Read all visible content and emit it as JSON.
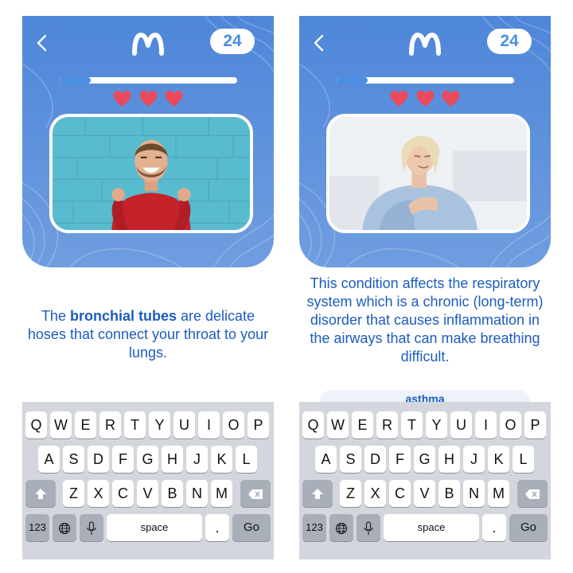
{
  "screens": [
    {
      "score": "24",
      "progress": 0.18,
      "hearts": 3,
      "photo": "smiling man in red sweater laughing against blue brick wall",
      "text_before": "The ",
      "term": "bronchial tubes",
      "text_after": " are delicate hoses that connect your throat to your lungs."
    },
    {
      "score": "24",
      "progress": 0.18,
      "hearts": 3,
      "photo": "woman holding chest, struggling to breathe",
      "text": "This condition affects the respiratory system which is a chronic (long-term) disorder that causes inflammation in the airways that can make breathing difficult.",
      "answer": "asthma"
    }
  ],
  "keyboard": {
    "row1": [
      "Q",
      "W",
      "E",
      "R",
      "T",
      "Y",
      "U",
      "I",
      "O",
      "P"
    ],
    "row2": [
      "A",
      "S",
      "D",
      "F",
      "G",
      "H",
      "J",
      "K",
      "L"
    ],
    "row3": [
      "Z",
      "X",
      "C",
      "V",
      "B",
      "N",
      "M"
    ],
    "numbers_label": "123",
    "space_label": "space",
    "period_label": ".",
    "go_label": "Go",
    "icons": [
      "shift-icon",
      "backspace-icon",
      "globe-icon",
      "microphone-icon"
    ]
  },
  "colors": {
    "header_blue": "#4e86d9",
    "accent_blue": "#4a90e2",
    "text_blue": "#1c5cbd",
    "heart_red": "#e94a5c",
    "keyboard_bg": "#d3d6dd"
  }
}
